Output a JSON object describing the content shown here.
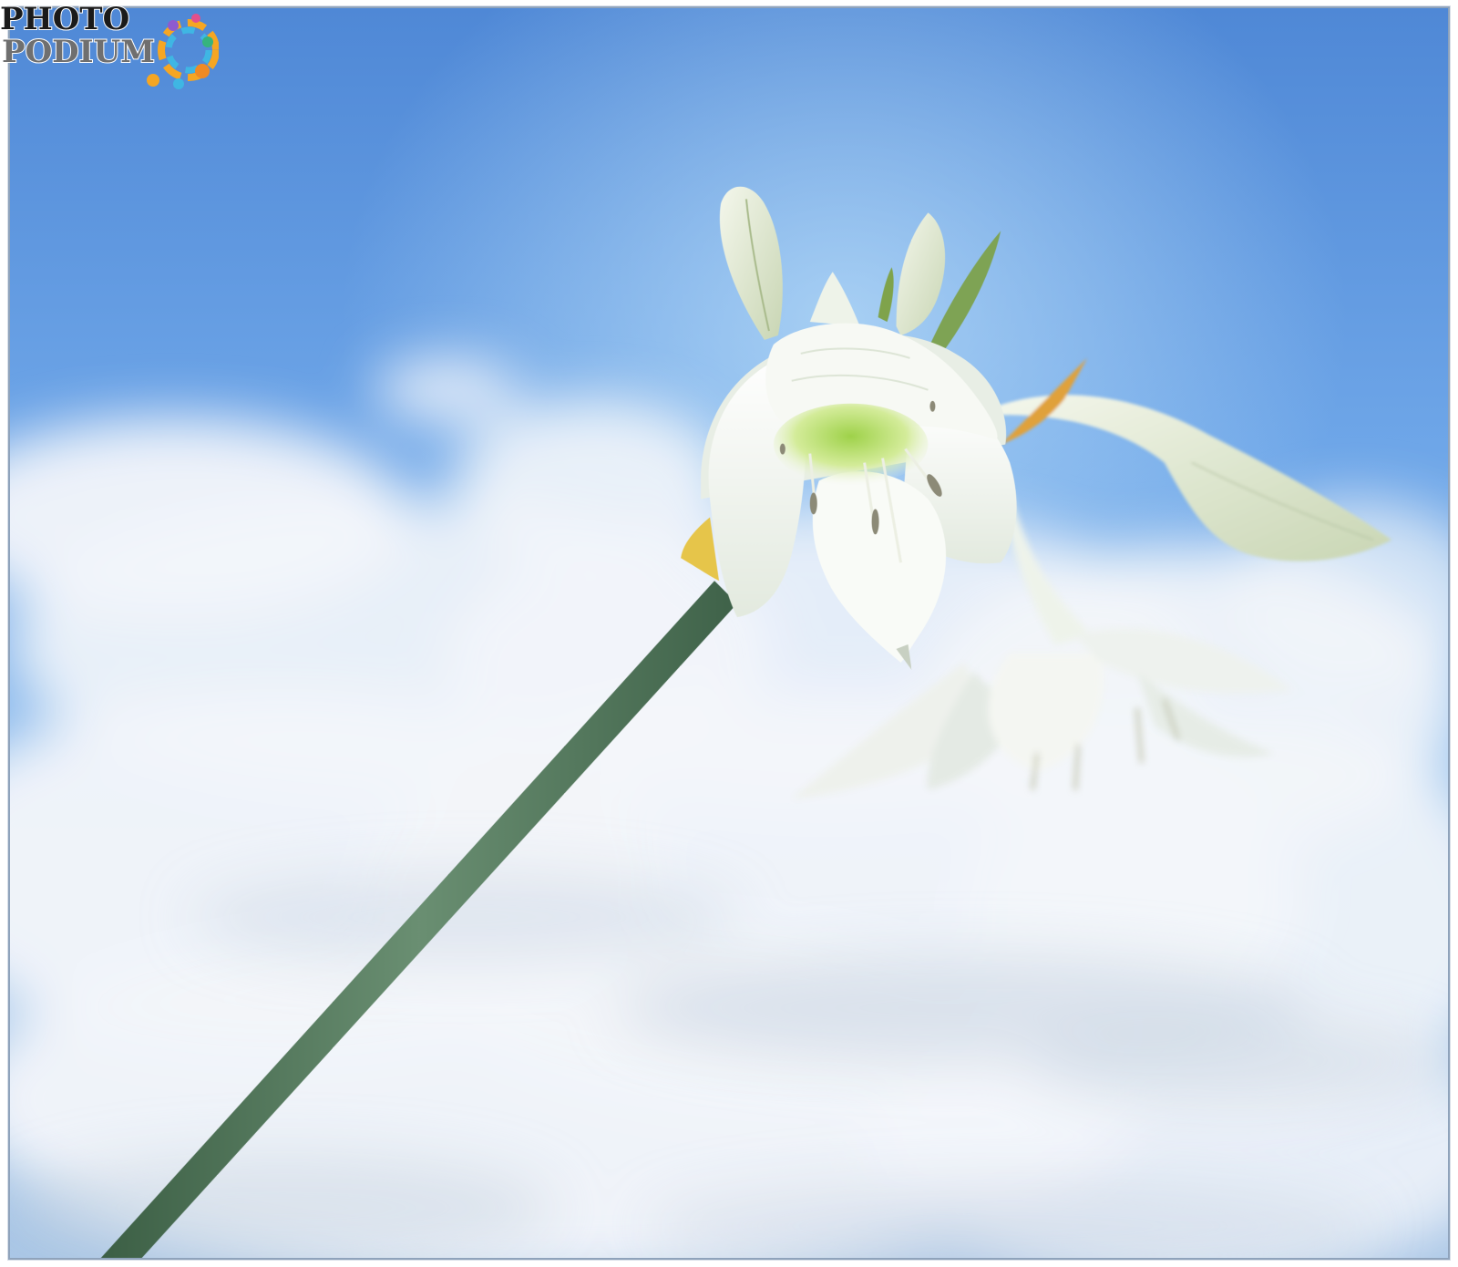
{
  "watermark": {
    "line1": "PHOTO",
    "line2": "PODIUM"
  },
  "colors": {
    "sky_top": "#5b93db",
    "sky_mid": "#7eb2ec",
    "cloud": "#f2f5f9",
    "stem": "#4f7458",
    "petal": "#f3f6f0",
    "petal_shade": "#d9e2d6",
    "throat": "#b9df6a",
    "frame_border": "#8fa3bb",
    "logo_dark": "#1a1a1a",
    "logo_grey": "#6f6f6f"
  }
}
